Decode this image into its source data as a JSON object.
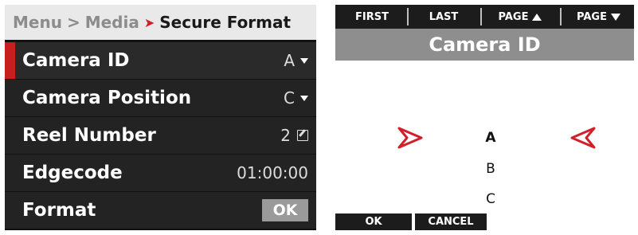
{
  "menu": {
    "breadcrumb": {
      "part1": "Menu",
      "sep": ">",
      "part2": "Media",
      "current": "Secure Format"
    },
    "rows": [
      {
        "label": "Camera ID",
        "value": "A",
        "control": "dropdown",
        "selected": true
      },
      {
        "label": "Camera Position",
        "value": "C",
        "control": "dropdown"
      },
      {
        "label": "Reel Number",
        "value": "2",
        "control": "edit"
      },
      {
        "label": "Edgecode",
        "value": "01:00:00",
        "control": "none"
      },
      {
        "label": "Format",
        "value": "OK",
        "control": "button"
      }
    ],
    "accent_color": "#c81e1e"
  },
  "picker": {
    "nav": {
      "first": "FIRST",
      "last": "LAST",
      "page_up": "PAGE",
      "page_down": "PAGE"
    },
    "title": "Camera ID",
    "options": [
      "A",
      "B",
      "C"
    ],
    "current": "A",
    "ok_label": "OK",
    "cancel_label": "CANCEL",
    "arrow_color": "#d0202a"
  }
}
